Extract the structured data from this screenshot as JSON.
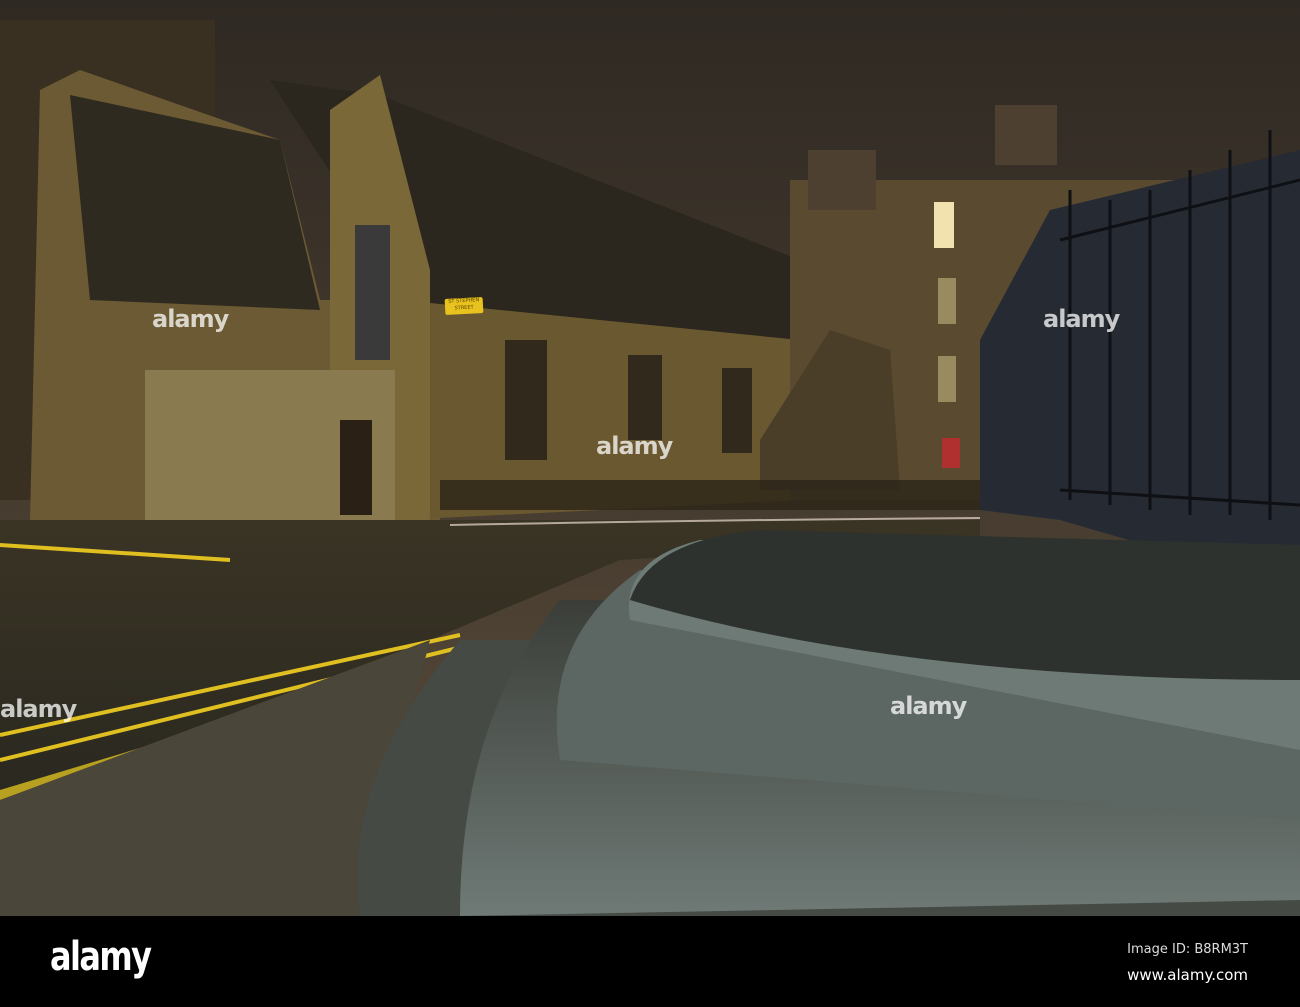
{
  "street_sign": "ST STEPHEN STREET",
  "watermark": "alamy",
  "footer": {
    "logo": "alamy",
    "image_id": "Image ID: B8RM3T",
    "url": "www.alamy.com"
  },
  "colors": {
    "sky": "#4a3f33",
    "stone": "#6b5a33",
    "steps": "#5a6260",
    "footer": "#000000"
  }
}
